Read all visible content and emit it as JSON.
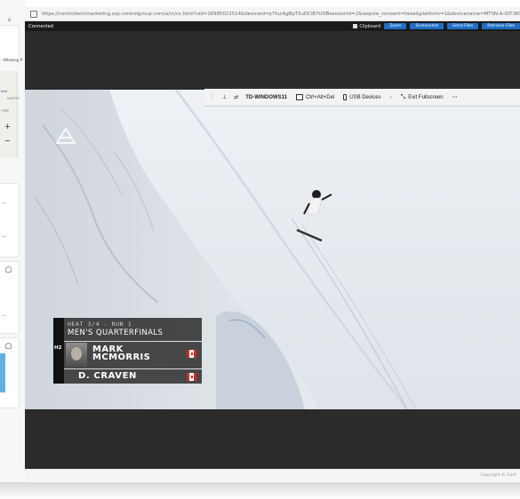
{
  "browser": {
    "url": "https://controltechmarketing.ssp.controlgroup.com/a/rc/cs.html?uid=16985021514&deviceid=p7fucAgBpT2uDCiB7UOBsessionid=2&require_consent=false&platform=1&devicename=MTSN-A-IOT.WORKGROUP"
  },
  "left_panel": {
    "title_fragment": "s",
    "missing_label": "Missing P",
    "map_labels": [
      "Mall",
      "NORTH",
      "PRE"
    ],
    "zoom_in": "+",
    "zoom_out": "−"
  },
  "session_toolbar": {
    "status": "Connected",
    "clipboard": "Clipboard",
    "buttons": [
      "Zoom",
      "Screenshot",
      "Send Files",
      "Retrieve Files"
    ]
  },
  "remote_toolbar": {
    "pin_icon": "pin-icon",
    "machine": "TD-WINDOWS11",
    "ctrl_alt_del": "Ctrl+Alt+Del",
    "usb": "USB Devices",
    "exit_fullscreen": "Exit Fullscreen",
    "more": "···"
  },
  "broadcast": {
    "heat": "HEAT 3/4 - RUN 1",
    "round": "MEN'S QUARTERFINALS",
    "badge": "H2",
    "rider1_first": "MARK",
    "rider1_last": "MCMORRIS",
    "rider2": "D. CRAVEN"
  },
  "footer": {
    "copyright": "Copyright © Cont"
  },
  "colors": {
    "session_bg": "#2b2b2b",
    "button_blue": "#1f6fc6",
    "snow": "#e9ecf0",
    "canada_red": "#d52b1e"
  }
}
